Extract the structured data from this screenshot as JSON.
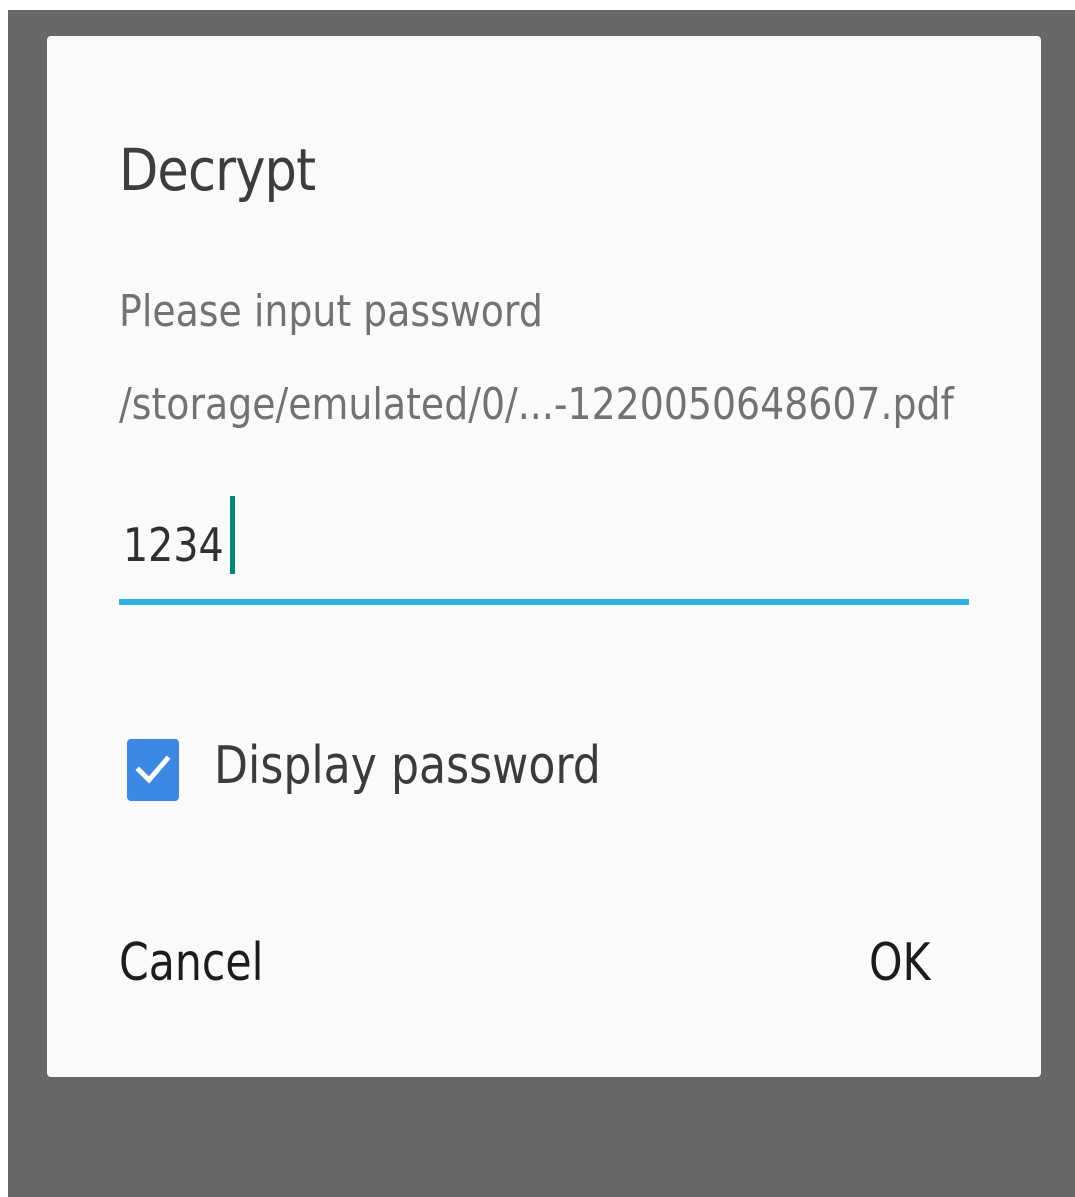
{
  "dialog": {
    "title": "Decrypt",
    "message": "Please input password",
    "file_path": "/storage/emulated/0/...-1220050648607.pdf",
    "password_value": "1234",
    "display_password": {
      "label": "Display password",
      "checked": true
    },
    "buttons": {
      "cancel_label": "Cancel",
      "ok_label": "OK"
    }
  },
  "colors": {
    "accent_underline": "#29b2e6",
    "caret": "#00897b",
    "checkbox": "#3b87e6",
    "scrim": "#676767",
    "dialog_bg": "#fafafa"
  },
  "icons": {
    "checkbox_mark": "check-icon"
  }
}
